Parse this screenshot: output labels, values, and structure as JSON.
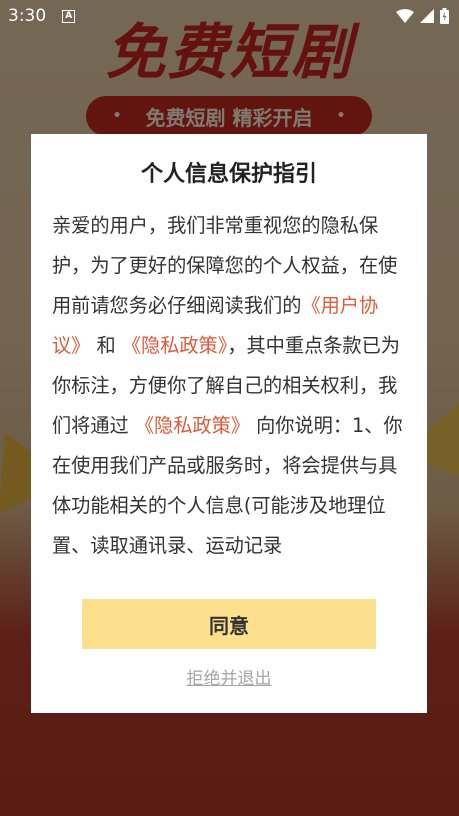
{
  "status_bar": {
    "time": "3:30",
    "notification_icon": "A"
  },
  "background": {
    "title": "免费短剧",
    "pill_text": "免费短剧 精彩开启",
    "pill_dot": "•"
  },
  "dialog": {
    "title": "个人信息保护指引",
    "body": {
      "p1": "亲爱的用户，我们非常重视您的隐私保护，为了更好的保障您的个人权益，在使用前请您务必仔细阅读我们的",
      "link_user_agreement": "《用户协议》",
      "and": "和",
      "link_privacy_1": "《隐私政策》",
      "p2": "，其中重点条款已为你标注，方便你了解自己的相关权利，我们将通过",
      "link_privacy_2": "《隐私政策》",
      "p3": "向你说明：1、你在使用我们产品或服务时，将会提供与具体功能相关的个人信息(可能涉及地理位置、读取通讯录、运动记录"
    },
    "agree_label": "同意",
    "refuse_label": "拒绝并退出"
  },
  "colors": {
    "accent_link": "#e05a3a",
    "agree_button": "#fde08d"
  }
}
